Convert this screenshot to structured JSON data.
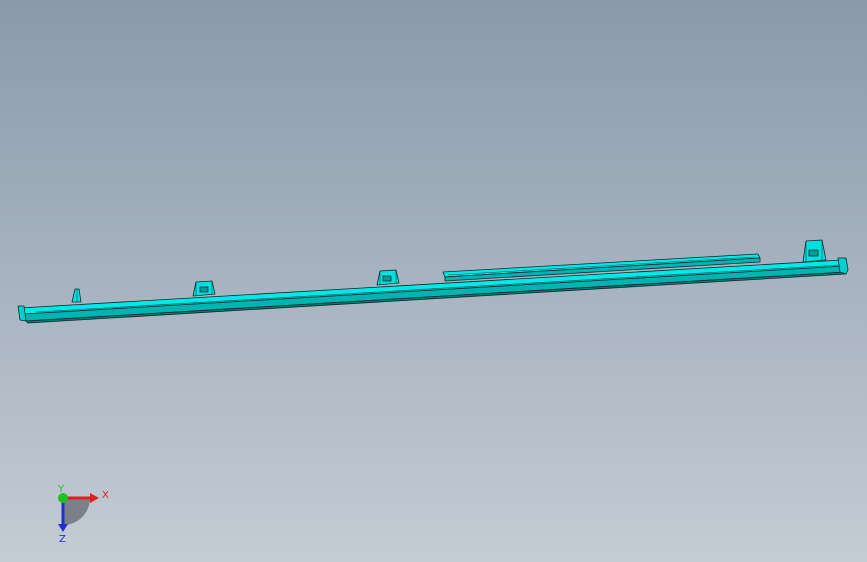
{
  "viewport": {
    "background_top": "#8a9aab",
    "background_bottom": "#c4ccd5",
    "part_color": "#00e8e8",
    "part_shade": "#00b4b4",
    "part_dark": "#007a7a",
    "edge_color": "#0c2a2a"
  },
  "triad": {
    "x_label": "X",
    "y_label": "Y",
    "z_label": "Z",
    "x_color": "#e02020",
    "y_color": "#20c020",
    "z_color": "#2030d0"
  }
}
